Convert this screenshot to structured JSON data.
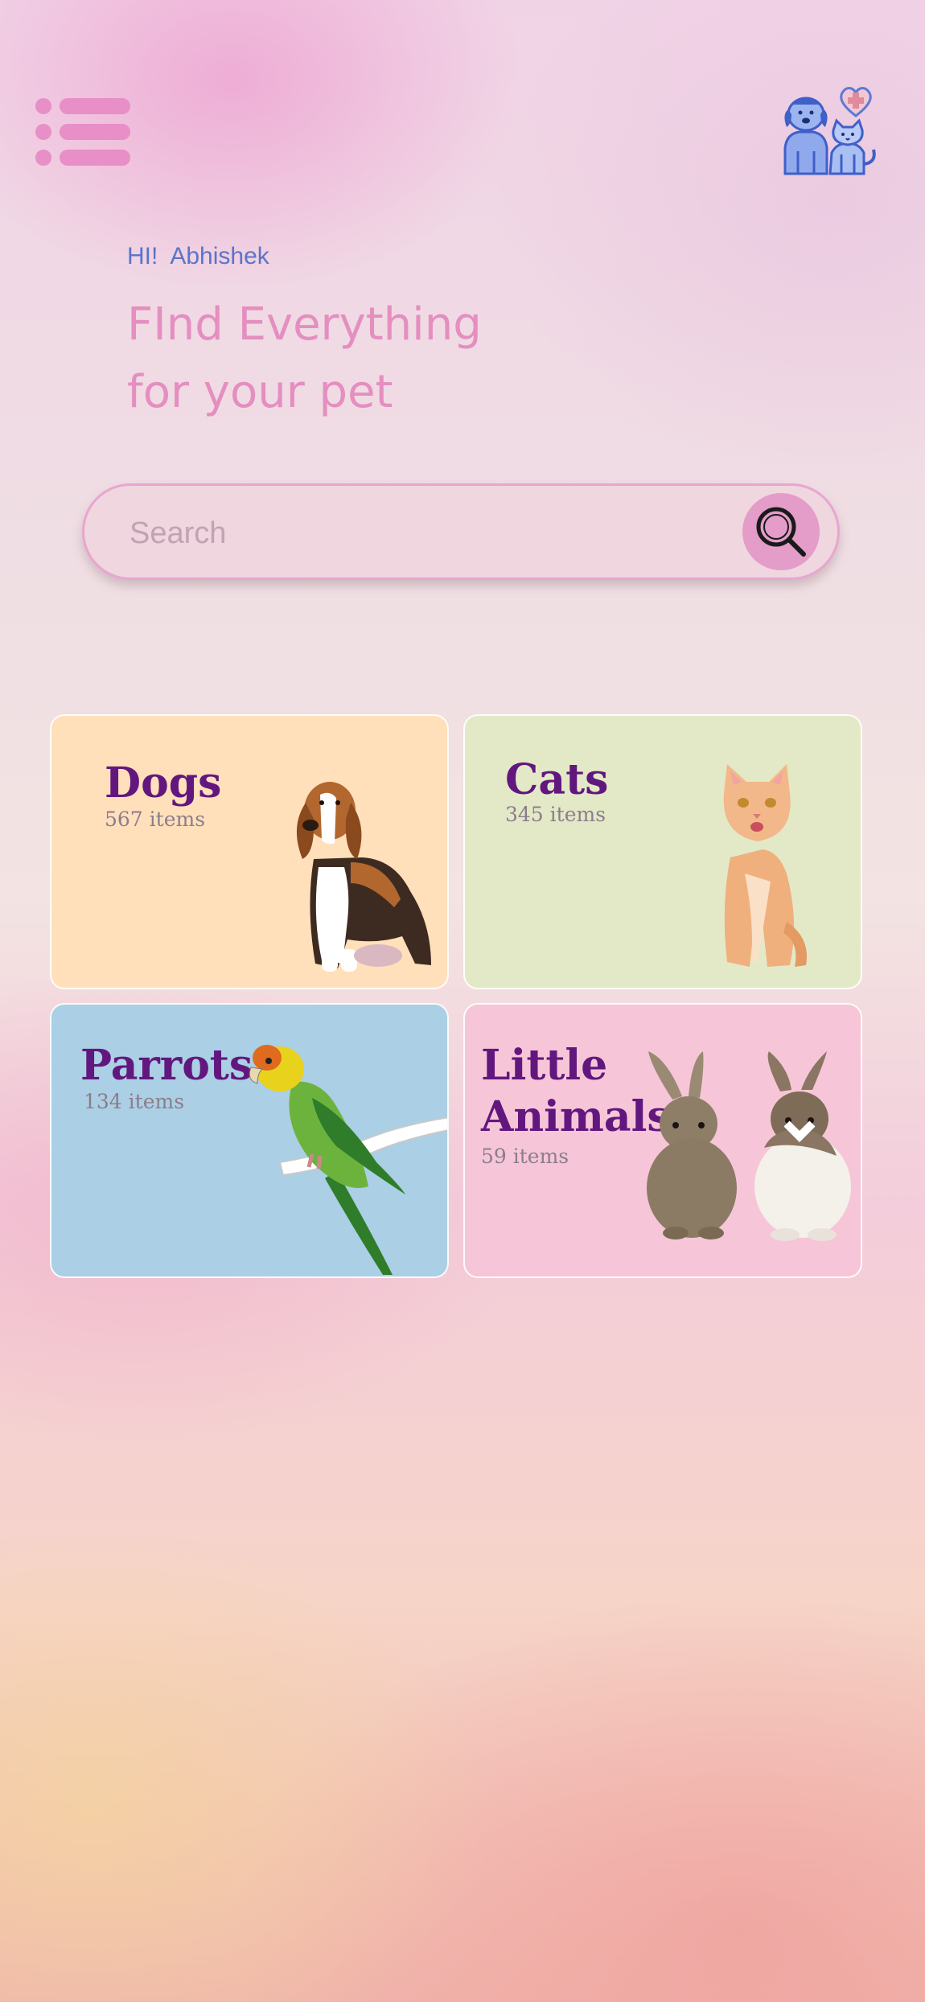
{
  "header": {
    "menu_icon": "hamburger-menu-icon",
    "logo_icon": "dog-cat-heart-logo-icon"
  },
  "greeting": {
    "hi": "HI!",
    "name": "Abhishek"
  },
  "headline": {
    "line1": "FInd Everything",
    "line2": "for your pet"
  },
  "search": {
    "placeholder": "Search",
    "icon": "search-icon"
  },
  "categories": [
    {
      "title": "Dogs",
      "count": "567 items",
      "bg": "#ffe0bb",
      "icon": "dog-image"
    },
    {
      "title": "Cats",
      "count": "345  items",
      "bg": "#e3e9c7",
      "icon": "cat-image"
    },
    {
      "title": "Parrots",
      "count": "134  items",
      "bg": "#abcfe4",
      "icon": "parrot-image"
    },
    {
      "title_line1": "Little",
      "title_line2": "Animals",
      "count": "59 items",
      "bg": "#f6c6d8",
      "icon": "rabbits-image"
    }
  ],
  "colors": {
    "accent_pink": "#e58ec0",
    "title_purple": "#62177e",
    "greeting_blue": "#5b74c9"
  }
}
